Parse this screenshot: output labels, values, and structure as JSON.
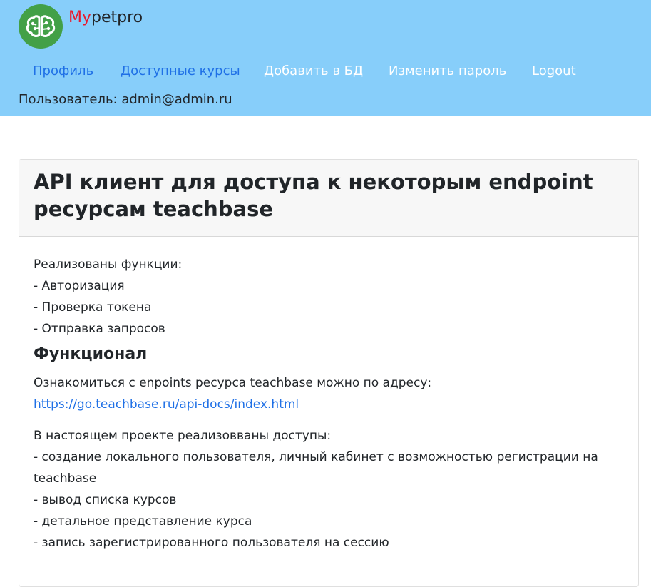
{
  "brand": {
    "accent": "My",
    "rest": "petpro"
  },
  "nav": {
    "items": [
      {
        "label": "Профиль"
      },
      {
        "label": "Доступные курсы"
      },
      {
        "label": "Добавить в БД"
      },
      {
        "label": "Изменить пароль"
      },
      {
        "label": "Logout"
      }
    ],
    "user_line": "Пользователь: admin@admin.ru"
  },
  "card": {
    "title_line1": "API клиент для доступа к некоторым endpoint",
    "title_line2": "ресурсам teachbase",
    "intro": [
      "Реализованы функции:",
      "- Авторизация",
      "- Проверка токена",
      "- Отправка запросов"
    ],
    "section_title": "Функционал",
    "docs_text": "Ознакомиться с enpoints ресурса teachbase можно по адресу:",
    "docs_link": "https://go.teachbase.ru/api-docs/index.html",
    "features": [
      "В настоящем проекте реализовваны доступы:",
      "- создание локального пользователя, личный кабинет с возможностью регистрации на",
      "teachbase",
      "- вывод списка курсов",
      "- детальное представление курса",
      "- запись зарегистрированного пользователя на сессию"
    ]
  },
  "colors": {
    "navbar": "#87cefa",
    "link": "#1f70e6",
    "brand_accent": "#e8192c",
    "logo": "#43a047"
  },
  "icons": {
    "logo": "brain-icon"
  }
}
